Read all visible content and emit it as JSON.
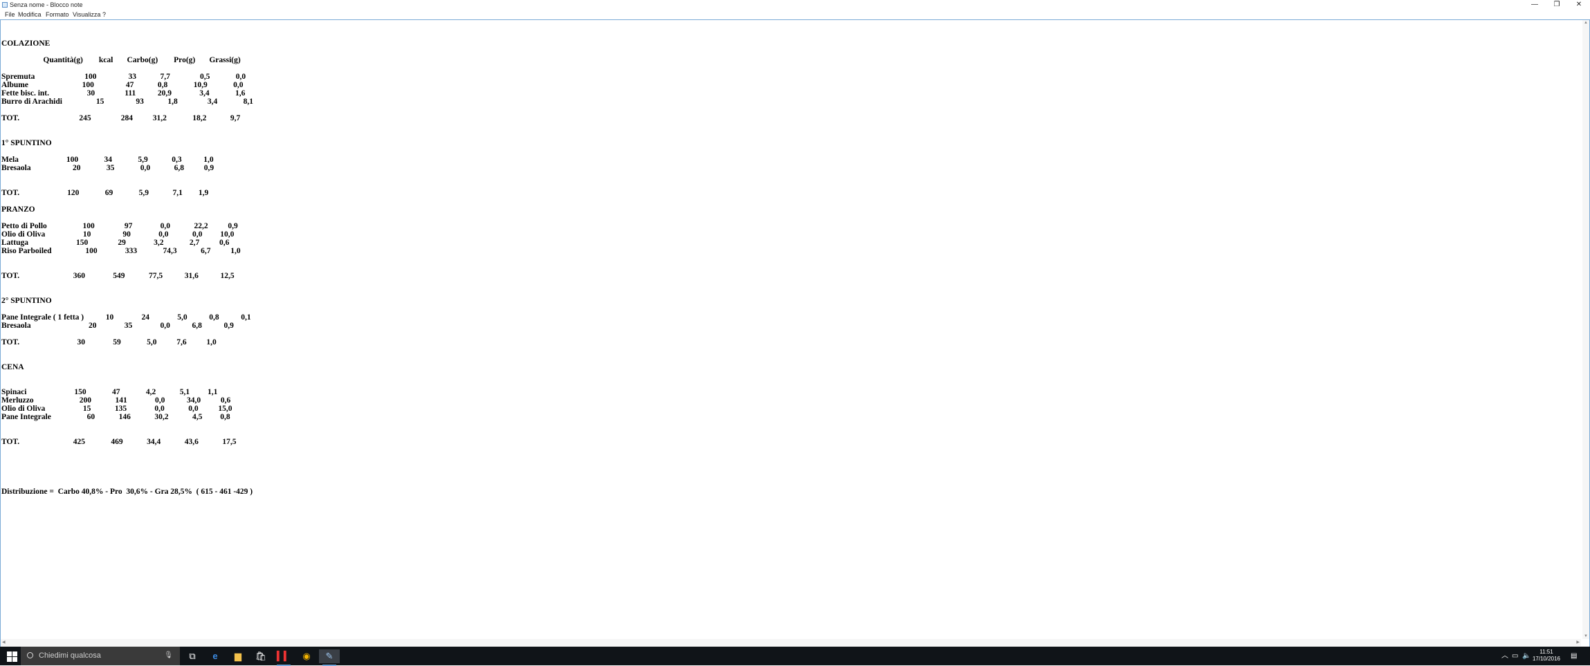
{
  "window": {
    "title": "Senza nome - Blocco note",
    "minimize": "—",
    "restore": "❐",
    "close": "✕"
  },
  "menu": [
    "File",
    "Modifica",
    "Formato",
    "Visualizza",
    "?"
  ],
  "lines": [
    "",
    "",
    "COLAZIONE",
    "",
    "                     Quantità(g)        kcal       Carbo(g)        Pro(g)       Grassi(g)",
    "",
    "Spremuta                         100                33            7,7               0,5             0,0",
    "Albume                           100                47            0,8             10,9             0,0",
    "Fette bisc. int.                   30               111           20,9              3,4             1,6",
    "Burro di Arachidi                 15                93            1,8               3,4             8,1",
    "",
    "TOT.                              245               284          31,2             18,2            9,7",
    "",
    "",
    "1° SPUNTINO",
    "",
    "Mela                        100             34             5,9            0,3           1,0",
    "Bresaola                     20             35             0,0            6,8          0,9",
    "",
    "",
    "TOT.                        120             69             5,9            7,1        1,9",
    "",
    "PRANZO",
    "",
    "Petto di Pollo                  100               97              0,0            22,2          0,9",
    "Olio di Oliva                   10                90              0,0            0,0         10,0",
    "Lattuga                        150               29              3,2             2,7          0,6",
    "Riso Parboiled                 100              333             74,3            6,7          1,0",
    "",
    "",
    "TOT.                           360              549            77,5           31,6           12,5",
    "",
    "",
    "2° SPUNTINO",
    "",
    "Pane Integrale ( 1 fetta )           10              24              5,0           0,8           0,1",
    "Bresaola                             20              35              0,0           6,8           0,9",
    "",
    "TOT.                             30              59             5,0          7,6          1,0",
    "",
    "",
    "CENA",
    "",
    "",
    "Spinaci                        150             47             4,2            5,1         1,1",
    "Merluzzo                       200            141              0,0           34,0          0,6",
    "Olio di Oliva                   15            135              0,0            0,0          15,0",
    "Pane Integrale                  60            146            30,2            4,5         0,8",
    "",
    "",
    "TOT.                           425             469            34,4            43,6            17,5",
    "",
    "",
    "",
    "",
    "",
    "Distribuzione =  Carbo 40,8% - Pro  30,6% - Gra 28,5%  ( 615 - 461 -429 )"
  ],
  "taskbar": {
    "search_placeholder": "Chiedimi qualcosa",
    "icons": [
      "task-view-icon",
      "edge-icon",
      "file-explorer-icon",
      "store-icon",
      "app-icon",
      "chrome-icon",
      "notepad-icon"
    ],
    "time": "11:51",
    "date": "17/10/2016"
  }
}
